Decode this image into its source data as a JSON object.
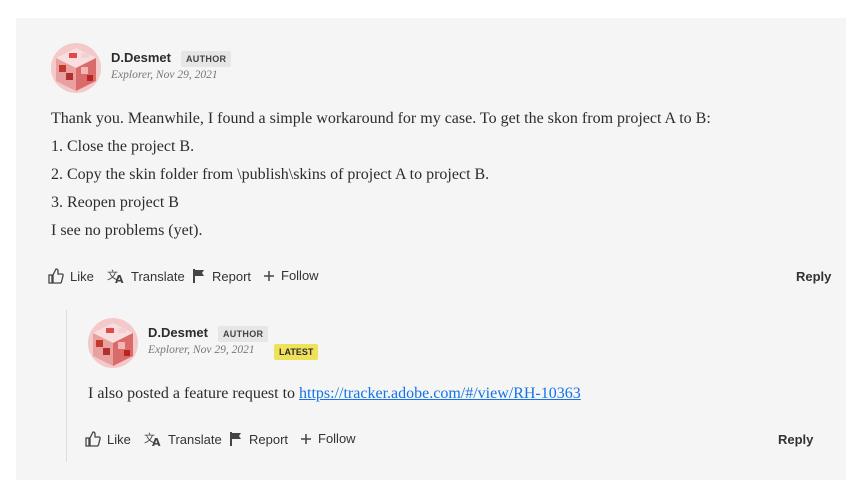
{
  "post": {
    "author": "D.Desmet",
    "badge": "AUTHOR",
    "meta": "Explorer, Nov 29, 2021",
    "lines": [
      "Thank you. Meanwhile, I found a simple workaround for my case. To get the skon from project A to B:",
      "1. Close the project B.",
      "2. Copy the skin folder from \\publish\\skins of project A to project B.",
      "3. Reopen project B",
      "I see no problems (yet)."
    ],
    "actions": {
      "like": "Like",
      "translate": "Translate",
      "report": "Report",
      "follow": "Follow",
      "reply": "Reply"
    }
  },
  "reply_post": {
    "author": "D.Desmet",
    "badge": "AUTHOR",
    "meta": "Explorer, Nov 29, 2021",
    "latest_badge": "LATEST",
    "text": "I also posted a feature request to ",
    "link": "https://tracker.adobe.com/#/view/RH-10363",
    "actions": {
      "like": "Like",
      "translate": "Translate",
      "report": "Report",
      "follow": "Follow",
      "reply": "Reply"
    }
  },
  "colors": {
    "panel_bg": "#f5f5f5",
    "link": "#1473e6",
    "latest_badge": "#f0e15a",
    "author_badge": "#e6e6e6"
  }
}
